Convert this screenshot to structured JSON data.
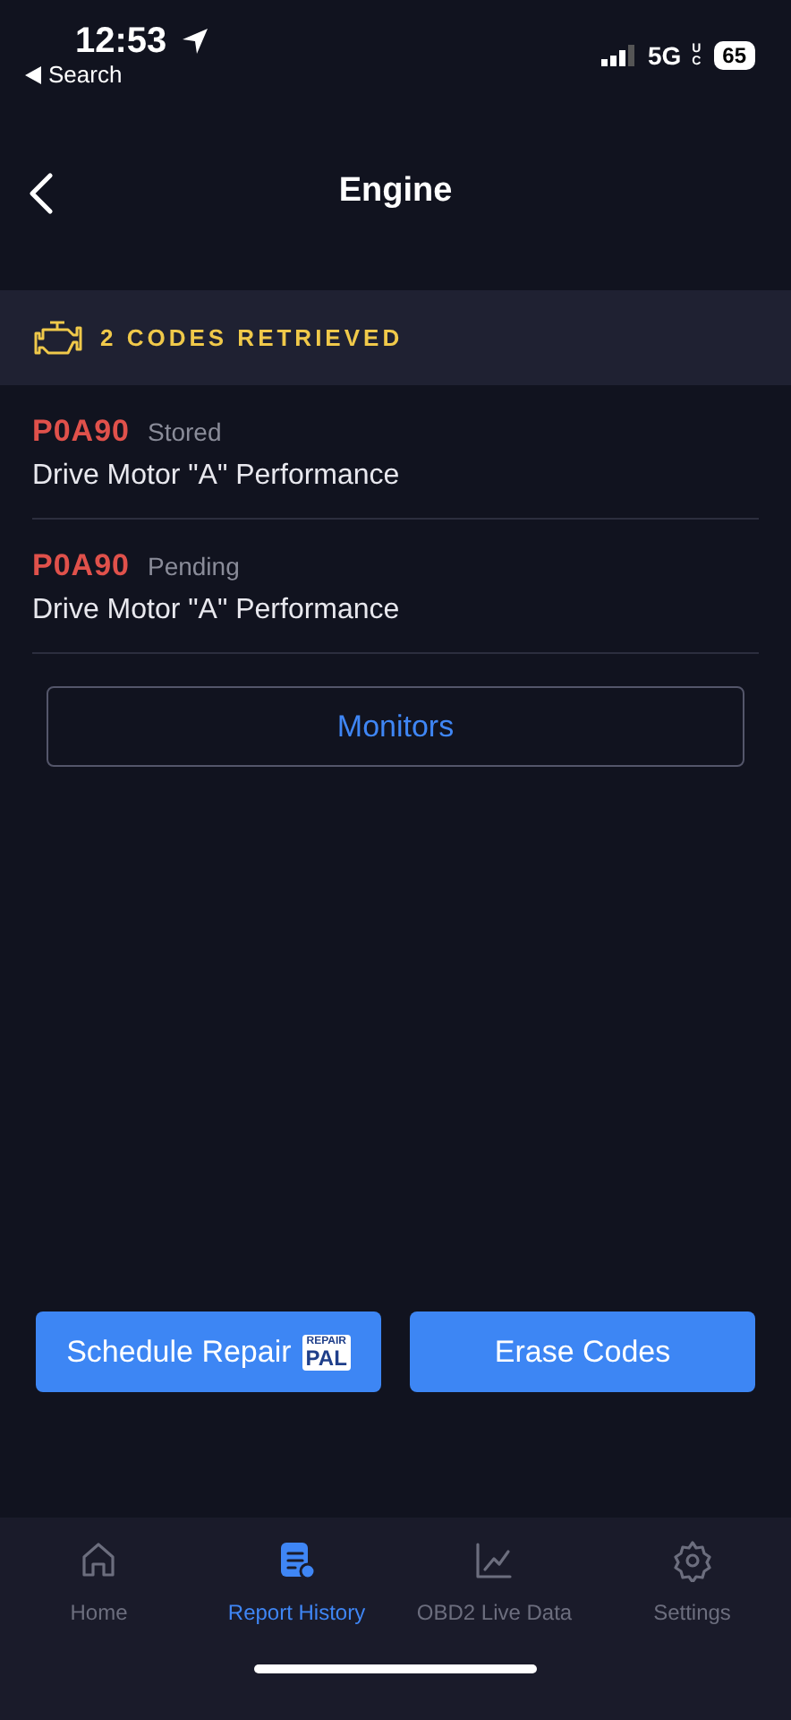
{
  "status_bar": {
    "time": "12:53",
    "back_app": "Search",
    "network": "5G",
    "network_sub": "UC",
    "battery": "65"
  },
  "header": {
    "title": "Engine"
  },
  "banner": {
    "text": "2 CODES RETRIEVED"
  },
  "codes": [
    {
      "code": "P0A90",
      "status": "Stored",
      "description": "Drive Motor \"A\" Performance"
    },
    {
      "code": "P0A90",
      "status": "Pending",
      "description": "Drive Motor \"A\" Performance"
    }
  ],
  "monitors_button": "Monitors",
  "actions": [
    {
      "kind": "repair",
      "label": "Schedule Repair",
      "badge_top": "REPAIR",
      "badge_bottom": "PAL"
    },
    {
      "kind": "plain",
      "label": "Erase Codes"
    }
  ],
  "tab_bar": [
    {
      "kind": "home",
      "label": "Home",
      "selected": false
    },
    {
      "kind": "report",
      "label": "Report History",
      "selected": true
    },
    {
      "kind": "chart",
      "label": "OBD2 Live Data",
      "selected": false
    },
    {
      "kind": "settings",
      "label": "Settings",
      "selected": false
    }
  ]
}
